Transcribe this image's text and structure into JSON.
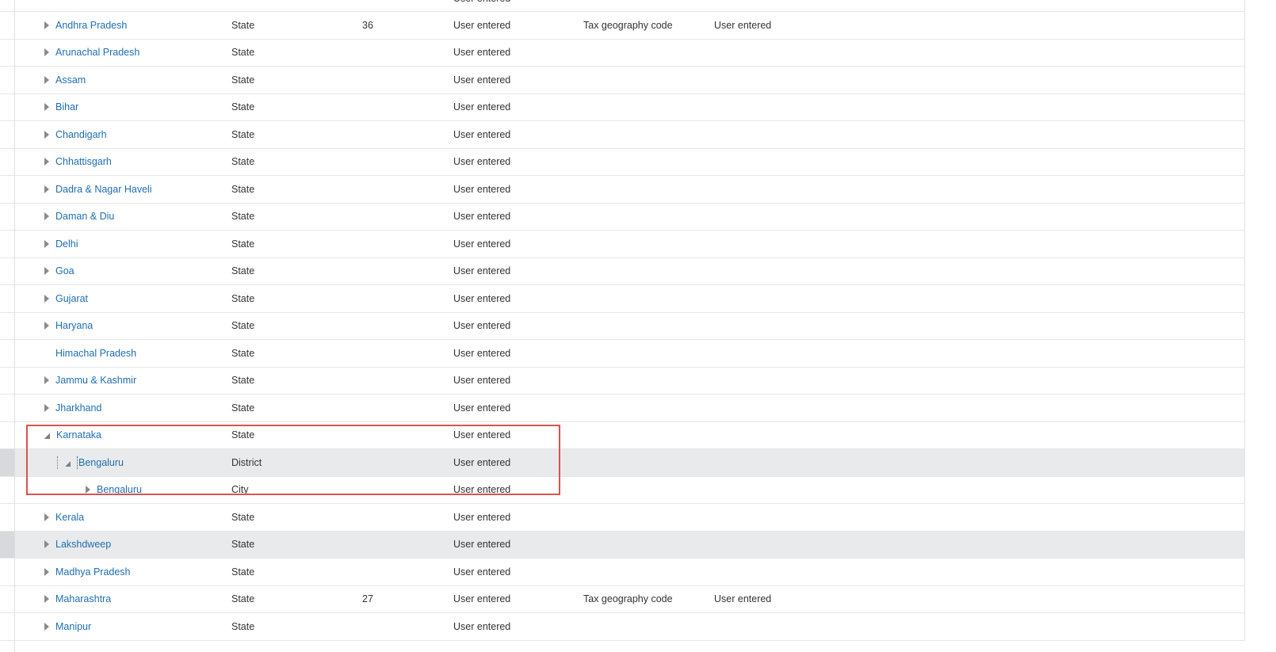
{
  "partial_top_row": {
    "source": "User entered"
  },
  "rows": [
    {
      "name": "Andhra Pradesh",
      "type": "State",
      "code": "36",
      "source": "User entered",
      "id_type": "Tax geography code",
      "id_source": "User entered",
      "level": 1,
      "toggle": "collapsed"
    },
    {
      "name": "Arunachal Pradesh",
      "type": "State",
      "code": "",
      "source": "User entered",
      "id_type": "",
      "id_source": "",
      "level": 1,
      "toggle": "collapsed"
    },
    {
      "name": "Assam",
      "type": "State",
      "code": "",
      "source": "User entered",
      "id_type": "",
      "id_source": "",
      "level": 1,
      "toggle": "collapsed"
    },
    {
      "name": "Bihar",
      "type": "State",
      "code": "",
      "source": "User entered",
      "id_type": "",
      "id_source": "",
      "level": 1,
      "toggle": "collapsed"
    },
    {
      "name": "Chandigarh",
      "type": "State",
      "code": "",
      "source": "User entered",
      "id_type": "",
      "id_source": "",
      "level": 1,
      "toggle": "collapsed"
    },
    {
      "name": "Chhattisgarh",
      "type": "State",
      "code": "",
      "source": "User entered",
      "id_type": "",
      "id_source": "",
      "level": 1,
      "toggle": "collapsed"
    },
    {
      "name": "Dadra & Nagar Haveli",
      "type": "State",
      "code": "",
      "source": "User entered",
      "id_type": "",
      "id_source": "",
      "level": 1,
      "toggle": "collapsed"
    },
    {
      "name": "Daman & Diu",
      "type": "State",
      "code": "",
      "source": "User entered",
      "id_type": "",
      "id_source": "",
      "level": 1,
      "toggle": "collapsed"
    },
    {
      "name": "Delhi",
      "type": "State",
      "code": "",
      "source": "User entered",
      "id_type": "",
      "id_source": "",
      "level": 1,
      "toggle": "collapsed"
    },
    {
      "name": "Goa",
      "type": "State",
      "code": "",
      "source": "User entered",
      "id_type": "",
      "id_source": "",
      "level": 1,
      "toggle": "collapsed"
    },
    {
      "name": "Gujarat",
      "type": "State",
      "code": "",
      "source": "User entered",
      "id_type": "",
      "id_source": "",
      "level": 1,
      "toggle": "collapsed"
    },
    {
      "name": "Haryana",
      "type": "State",
      "code": "",
      "source": "User entered",
      "id_type": "",
      "id_source": "",
      "level": 1,
      "toggle": "collapsed"
    },
    {
      "name": "Himachal Pradesh",
      "type": "State",
      "code": "",
      "source": "User entered",
      "id_type": "",
      "id_source": "",
      "level": 1,
      "toggle": "none"
    },
    {
      "name": "Jammu & Kashmir",
      "type": "State",
      "code": "",
      "source": "User entered",
      "id_type": "",
      "id_source": "",
      "level": 1,
      "toggle": "collapsed"
    },
    {
      "name": "Jharkhand",
      "type": "State",
      "code": "",
      "source": "User entered",
      "id_type": "",
      "id_source": "",
      "level": 1,
      "toggle": "collapsed"
    },
    {
      "name": "Karnataka",
      "type": "State",
      "code": "",
      "source": "User entered",
      "id_type": "",
      "id_source": "",
      "level": 1,
      "toggle": "expanded"
    },
    {
      "name": "Bengaluru",
      "type": "District",
      "code": "",
      "source": "User entered",
      "id_type": "",
      "id_source": "",
      "level": 2,
      "toggle": "expanded",
      "highlight": true
    },
    {
      "name": "Bengaluru",
      "type": "City",
      "code": "",
      "source": "User entered",
      "id_type": "",
      "id_source": "",
      "level": 3,
      "toggle": "collapsed"
    },
    {
      "name": "Kerala",
      "type": "State",
      "code": "",
      "source": "User entered",
      "id_type": "",
      "id_source": "",
      "level": 1,
      "toggle": "collapsed"
    },
    {
      "name": "Lakshdweep",
      "type": "State",
      "code": "",
      "source": "User entered",
      "id_type": "",
      "id_source": "",
      "level": 1,
      "toggle": "collapsed",
      "highlight": true
    },
    {
      "name": "Madhya Pradesh",
      "type": "State",
      "code": "",
      "source": "User entered",
      "id_type": "",
      "id_source": "",
      "level": 1,
      "toggle": "collapsed"
    },
    {
      "name": "Maharashtra",
      "type": "State",
      "code": "27",
      "source": "User entered",
      "id_type": "Tax geography code",
      "id_source": "User entered",
      "level": 1,
      "toggle": "collapsed"
    },
    {
      "name": "Manipur",
      "type": "State",
      "code": "",
      "source": "User entered",
      "id_type": "",
      "id_source": "",
      "level": 1,
      "toggle": "collapsed"
    }
  ],
  "colors": {
    "link": "#1f6eb0",
    "highlight_row": "#e9eaec",
    "annotation_box": "#d9534f"
  }
}
